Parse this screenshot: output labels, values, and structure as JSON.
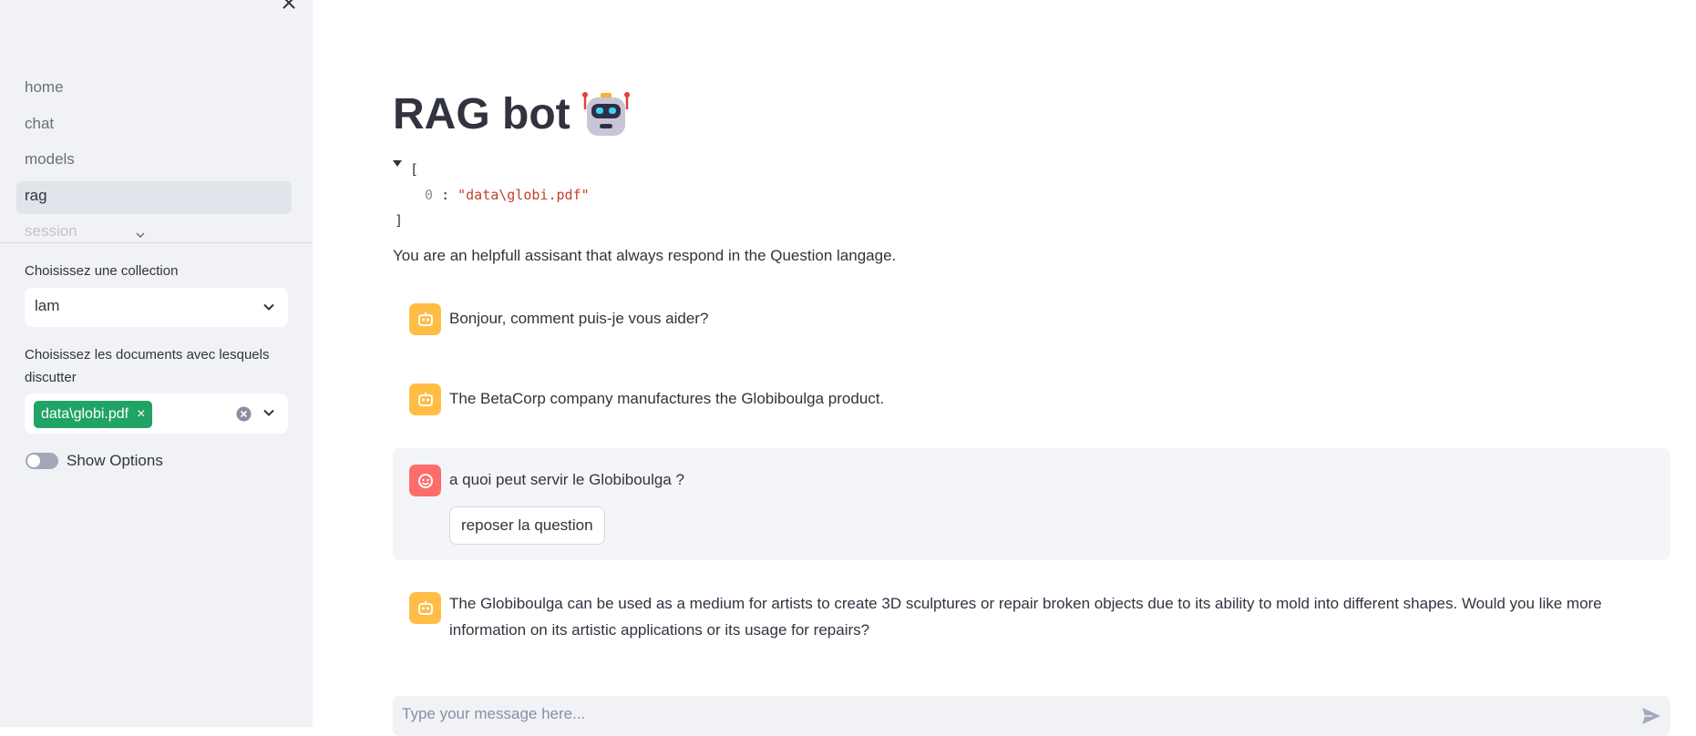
{
  "sidebar": {
    "nav_items": [
      {
        "label": "home"
      },
      {
        "label": "chat"
      },
      {
        "label": "models"
      },
      {
        "label": "rag"
      },
      {
        "label": "session"
      }
    ],
    "collection_label": "Choisissez une collection",
    "collection_value": "lam",
    "documents_label": "Choisissez les documents avec lesquels discutter",
    "documents_tag": "data\\globi.pdf",
    "tag_remove_symbol": "×",
    "show_options_label": "Show Options"
  },
  "main": {
    "title": "RAG bot",
    "json_open": "[",
    "json_index": "0",
    "json_colon": ":",
    "json_value": "\"data\\globi.pdf\"",
    "json_close": "]",
    "system_text": "You are an helpfull assisant that always respond in the Question langage.",
    "messages": [
      {
        "role": "assistant",
        "text": "Bonjour, comment puis-je vous aider?"
      },
      {
        "role": "assistant",
        "text": "The BetaCorp company manufactures the Globiboulga product."
      },
      {
        "role": "user",
        "text": "a quoi peut servir le Globiboulga ?",
        "button": "reposer la question"
      },
      {
        "role": "assistant",
        "text": "The Globiboulga can be used as a medium for artists to create 3D sculptures or repair broken objects due to its ability to mold into different shapes. Would you like more information on its artistic applications or its usage for repairs?"
      }
    ],
    "chat_placeholder": "Type your message here..."
  },
  "colors": {
    "accent_green": "#21a366",
    "bot_avatar": "#ffbd45",
    "user_avatar": "#ff6c6c",
    "sidebar_bg": "#f0f2f6"
  }
}
